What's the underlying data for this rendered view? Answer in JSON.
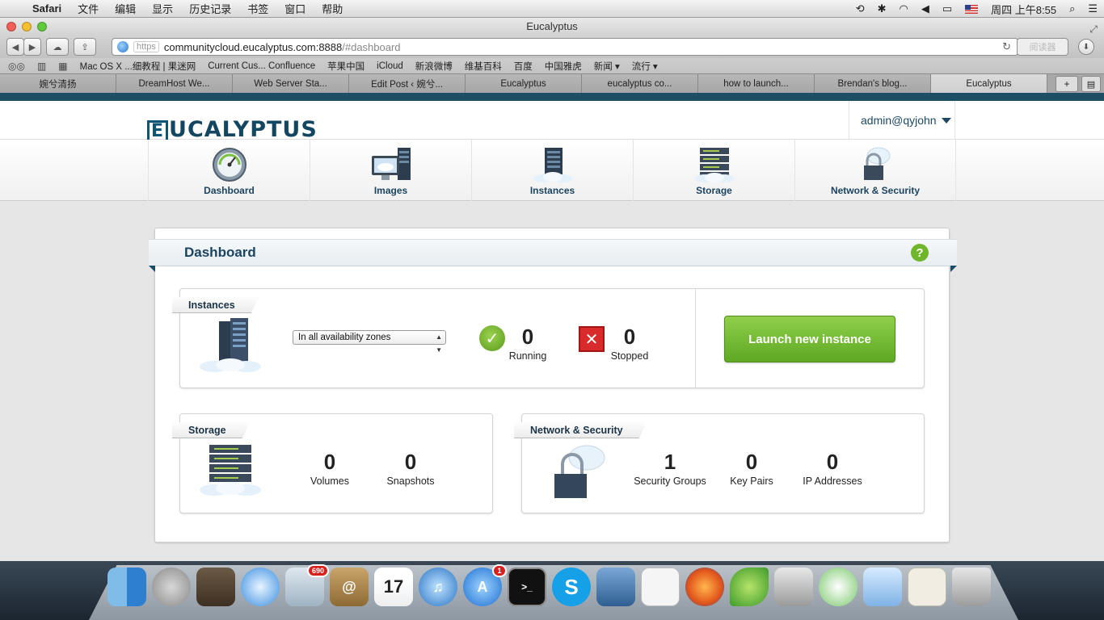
{
  "os_menubar": {
    "app_name": "Safari",
    "menus": [
      "文件",
      "编辑",
      "显示",
      "历史记录",
      "书签",
      "窗口",
      "帮助"
    ],
    "clock": "周四 上午8:55"
  },
  "browser": {
    "window_title": "Eucalyptus",
    "url_scheme": "https",
    "url_host": "communitycloud.eucalyptus.com:8888",
    "url_path": "/#dashboard",
    "reader_label": "阅读器",
    "bookmarks": [
      "Mac OS X ...细教程 | 果迷网",
      "Current Cus... Confluence",
      "苹果中国",
      "iCloud",
      "新浪微博",
      "维基百科",
      "百度",
      "中国雅虎",
      "新闻 ▾",
      "流行 ▾"
    ],
    "tabs": [
      "婉兮清扬",
      "DreamHost We...",
      "Web Server Sta...",
      "Edit Post ‹ 婉兮...",
      "Eucalyptus",
      "eucalyptus co...",
      "how to launch...",
      "Brendan's blog...",
      "Eucalyptus"
    ],
    "active_tab_index": 8
  },
  "app": {
    "logo_text": "UCALYPTUS",
    "logo_initial": "E",
    "user": "admin@qyjohn",
    "nav": [
      {
        "label": "Dashboard",
        "icon": "gauge-icon"
      },
      {
        "label": "Images",
        "icon": "monitor-icon"
      },
      {
        "label": "Instances",
        "icon": "server-cloud-icon"
      },
      {
        "label": "Storage",
        "icon": "storage-stack-icon"
      },
      {
        "label": "Network & Security",
        "icon": "lock-cloud-icon"
      }
    ]
  },
  "dashboard": {
    "title": "Dashboard",
    "help_label": "?",
    "instances": {
      "label": "Instances",
      "zone_select_value": "In all availability zones",
      "running_count": "0",
      "running_label": "Running",
      "stopped_count": "0",
      "stopped_label": "Stopped",
      "launch_label": "Launch new instance"
    },
    "storage": {
      "label": "Storage",
      "volumes_count": "0",
      "volumes_label": "Volumes",
      "snapshots_count": "0",
      "snapshots_label": "Snapshots"
    },
    "network": {
      "label": "Network & Security",
      "groups_count": "1",
      "groups_label": "Security Groups",
      "keypairs_count": "0",
      "keypairs_label": "Key Pairs",
      "ips_count": "0",
      "ips_label": "IP Addresses"
    }
  },
  "dock": {
    "apps": [
      "finder-icon",
      "launchpad-icon",
      "photo-icon",
      "safari-icon",
      "mail-icon",
      "contacts-icon",
      "calendar-icon",
      "itunes-icon",
      "app-store-icon",
      "terminal-icon",
      "skype-icon",
      "virtualbox-icon",
      "textedit-icon",
      "firefox-icon",
      "leaf-icon",
      "calculator-icon",
      "adium-icon",
      "cube-icon",
      "preview-icon",
      "trash-icon"
    ],
    "mail_badge": "690",
    "appstore_badge": "1",
    "calendar_day": "17"
  },
  "colors": {
    "brand": "#1b4460",
    "accent_green": "#6fb62a",
    "stop_red": "#d92b2b"
  }
}
